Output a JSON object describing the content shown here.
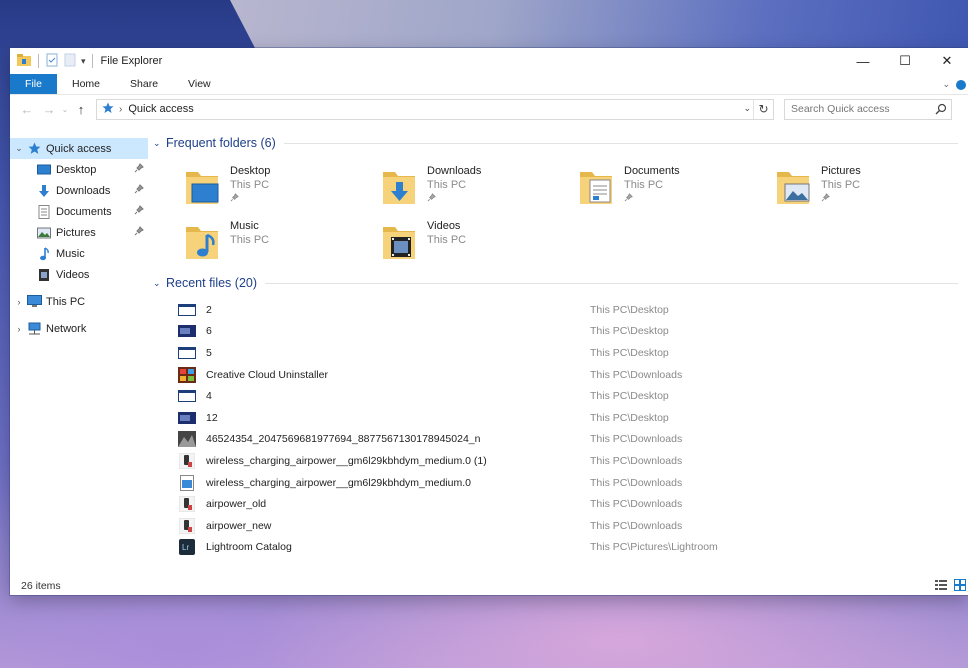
{
  "window": {
    "title": "File Explorer",
    "controls": {
      "minimize": "—",
      "maximize": "☐",
      "close": "✕"
    }
  },
  "ribbon": {
    "tabs": [
      "File",
      "Home",
      "Share",
      "View"
    ]
  },
  "address": {
    "breadcrumb": "Quick access",
    "search_placeholder": "Search Quick access"
  },
  "nav": {
    "quick_access": "Quick access",
    "items": [
      {
        "label": "Desktop",
        "icon": "desktop-icon",
        "pinned": true
      },
      {
        "label": "Downloads",
        "icon": "downloads-icon",
        "pinned": true
      },
      {
        "label": "Documents",
        "icon": "documents-icon",
        "pinned": true
      },
      {
        "label": "Pictures",
        "icon": "pictures-icon",
        "pinned": true
      },
      {
        "label": "Music",
        "icon": "music-icon",
        "pinned": false
      },
      {
        "label": "Videos",
        "icon": "videos-icon",
        "pinned": false
      }
    ],
    "this_pc": "This PC",
    "network": "Network"
  },
  "frequent": {
    "header": "Frequent folders (6)",
    "folders": [
      {
        "name": "Desktop",
        "location": "This PC",
        "pinned": true,
        "icon": "desktop"
      },
      {
        "name": "Downloads",
        "location": "This PC",
        "pinned": true,
        "icon": "downloads"
      },
      {
        "name": "Documents",
        "location": "This PC",
        "pinned": true,
        "icon": "documents"
      },
      {
        "name": "Pictures",
        "location": "This PC",
        "pinned": true,
        "icon": "pictures"
      },
      {
        "name": "Music",
        "location": "This PC",
        "pinned": false,
        "icon": "music"
      },
      {
        "name": "Videos",
        "location": "This PC",
        "pinned": false,
        "icon": "videos"
      }
    ]
  },
  "recent": {
    "header": "Recent files (20)",
    "files": [
      {
        "name": "2",
        "path": "This PC\\Desktop",
        "icon": "screenshot-light"
      },
      {
        "name": "6",
        "path": "This PC\\Desktop",
        "icon": "screenshot-dark"
      },
      {
        "name": "5",
        "path": "This PC\\Desktop",
        "icon": "screenshot-light"
      },
      {
        "name": "Creative Cloud Uninstaller",
        "path": "This PC\\Downloads",
        "icon": "creative-cloud"
      },
      {
        "name": "4",
        "path": "This PC\\Desktop",
        "icon": "screenshot-light"
      },
      {
        "name": "12",
        "path": "This PC\\Desktop",
        "icon": "screenshot-dark"
      },
      {
        "name": "46524354_2047569681977694_8877567130178945024_n",
        "path": "This PC\\Downloads",
        "icon": "photo"
      },
      {
        "name": "wireless_charging_airpower__gm6l29kbhdym_medium.0 (1)",
        "path": "This PC\\Downloads",
        "icon": "phone-image"
      },
      {
        "name": "wireless_charging_airpower__gm6l29kbhdym_medium.0",
        "path": "This PC\\Downloads",
        "icon": "image-file"
      },
      {
        "name": "airpower_old",
        "path": "This PC\\Downloads",
        "icon": "phone-image"
      },
      {
        "name": "airpower_new",
        "path": "This PC\\Downloads",
        "icon": "phone-image"
      },
      {
        "name": "Lightroom Catalog",
        "path": "This PC\\Pictures\\Lightroom",
        "icon": "lightroom"
      }
    ]
  },
  "status": {
    "item_count": "26 items"
  },
  "colors": {
    "accent": "#1979ca",
    "selection": "#cce8ff",
    "group_header": "#1e3f8a",
    "folder": "#f3c85a"
  }
}
